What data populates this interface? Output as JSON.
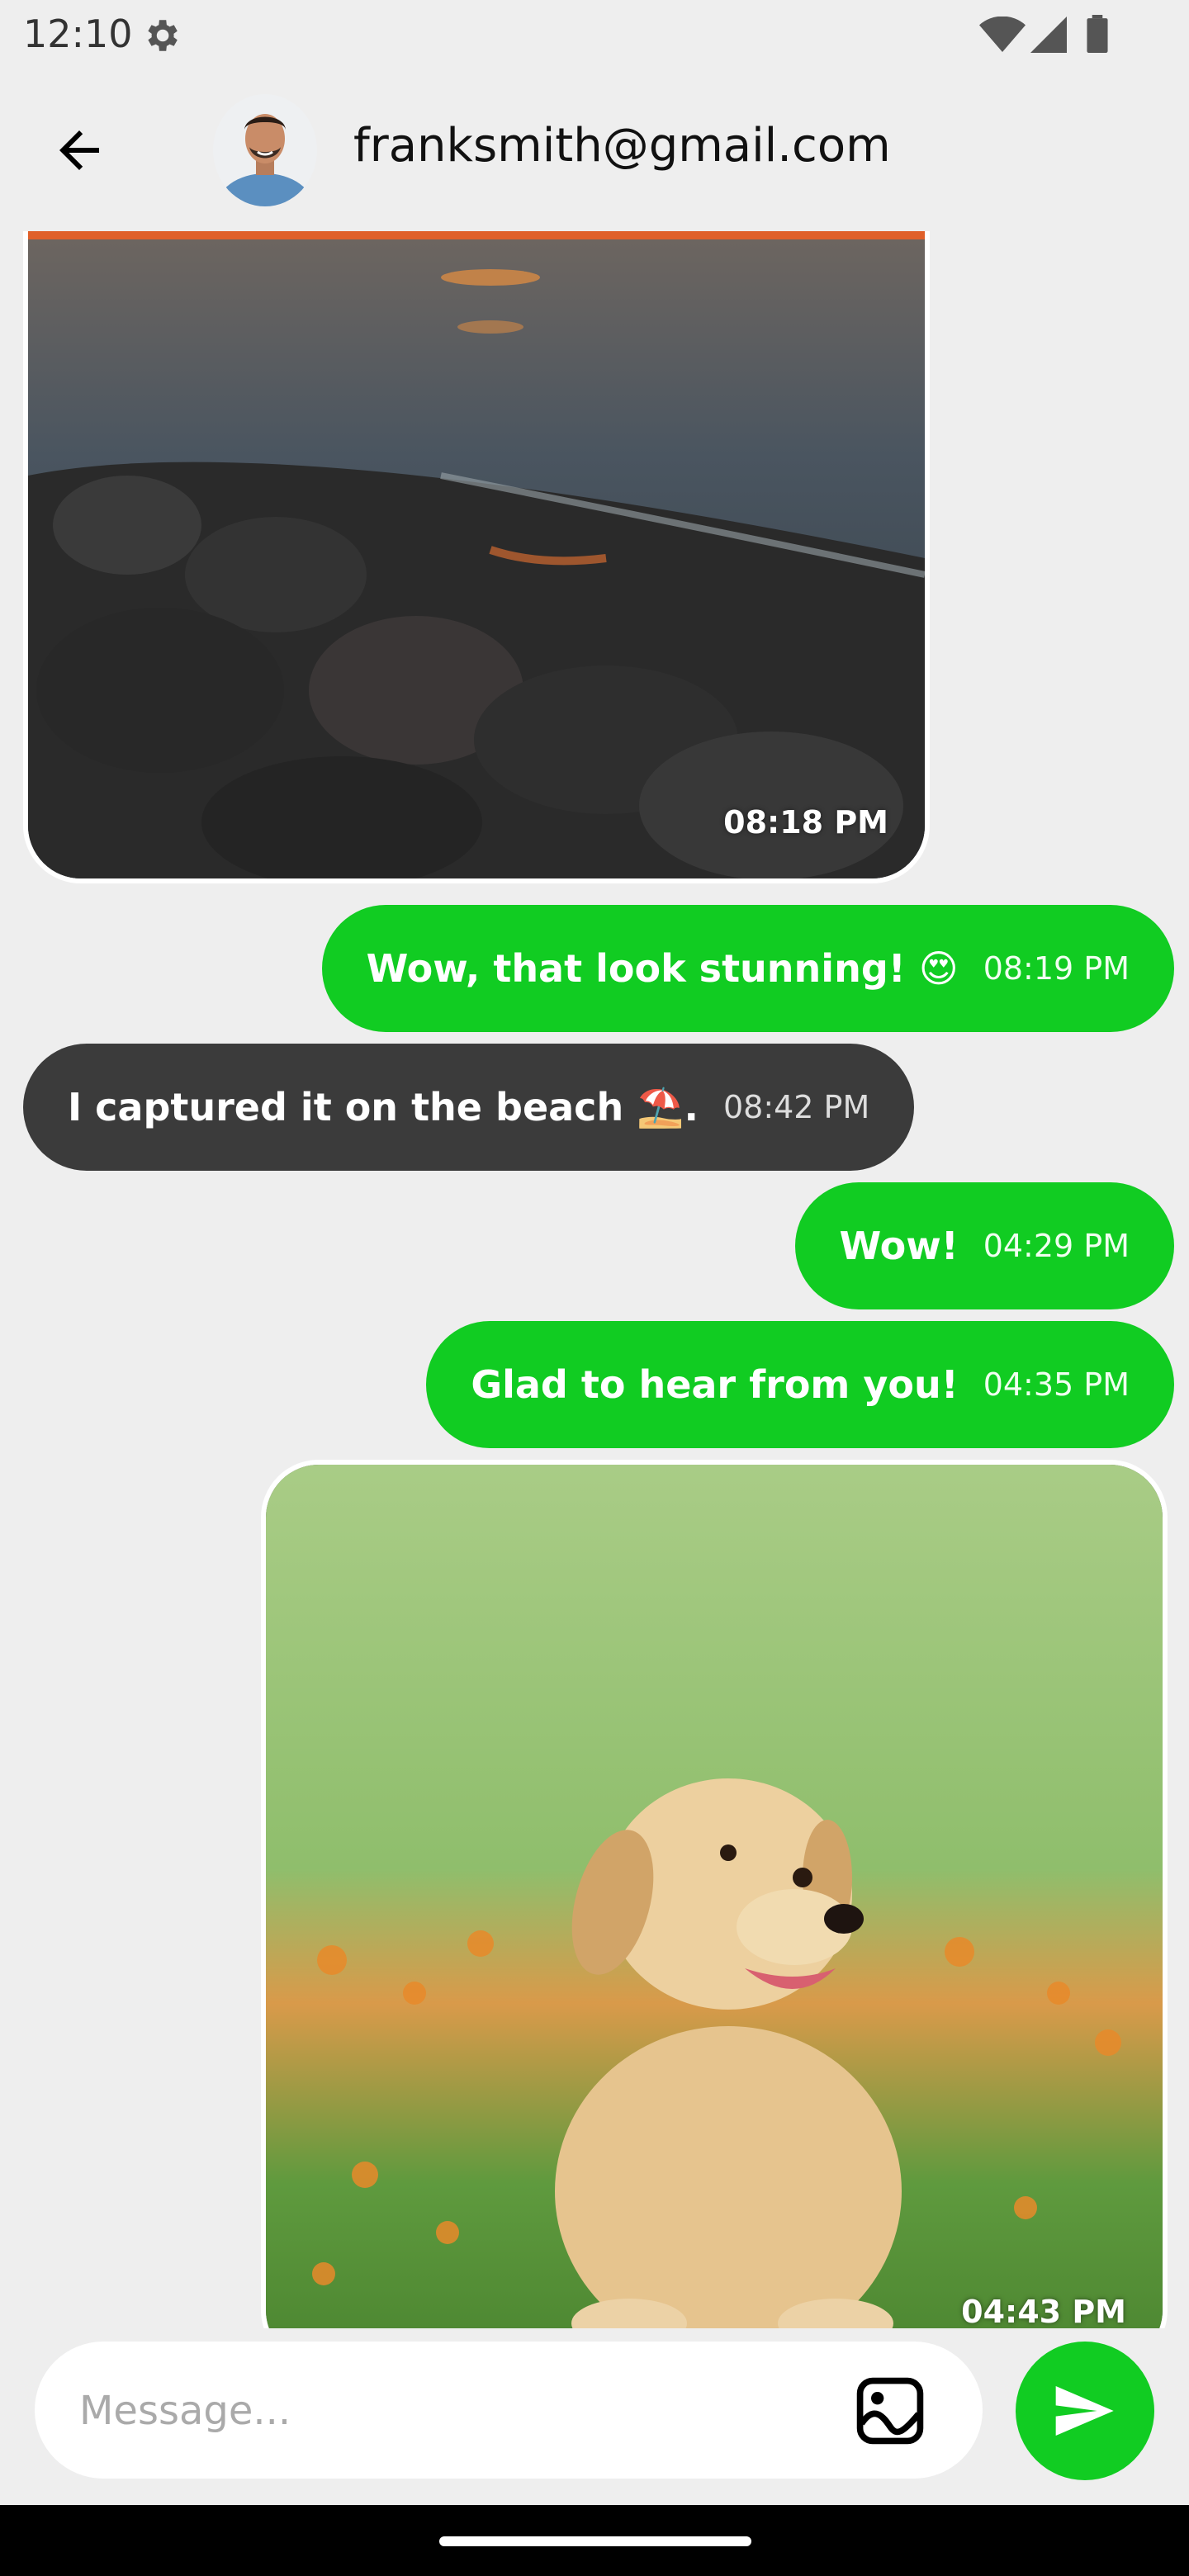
{
  "status_bar": {
    "time": "12:10",
    "icons": [
      "gear-icon",
      "wifi-icon",
      "signal-icon",
      "battery-icon"
    ]
  },
  "header": {
    "contact_name": "franksmith@gmail.com",
    "icons": [
      "back-arrow-icon",
      "avatar"
    ]
  },
  "messages": [
    {
      "type": "image",
      "direction": "incoming",
      "subject": "beach sunset",
      "time": "08:18 PM"
    },
    {
      "type": "text",
      "direction": "outgoing",
      "text": "Wow, that look stunning! 😍",
      "time": "08:19 PM"
    },
    {
      "type": "text",
      "direction": "incoming",
      "text": "I captured it on the beach ⛱️.",
      "time": "08:42 PM"
    },
    {
      "type": "text",
      "direction": "outgoing",
      "text": "Wow!",
      "time": "04:29 PM"
    },
    {
      "type": "text",
      "direction": "outgoing",
      "text": "Glad to hear from you!",
      "time": "04:35 PM"
    },
    {
      "type": "image",
      "direction": "outgoing",
      "subject": "puppy",
      "time": "04:43 PM"
    }
  ],
  "composer": {
    "placeholder": "Message...",
    "icons": [
      "gallery-icon",
      "send-icon"
    ]
  },
  "colors": {
    "accent": "#11cc22",
    "incoming_bubble": "#3b3b3b",
    "background": "#eeeeee"
  }
}
